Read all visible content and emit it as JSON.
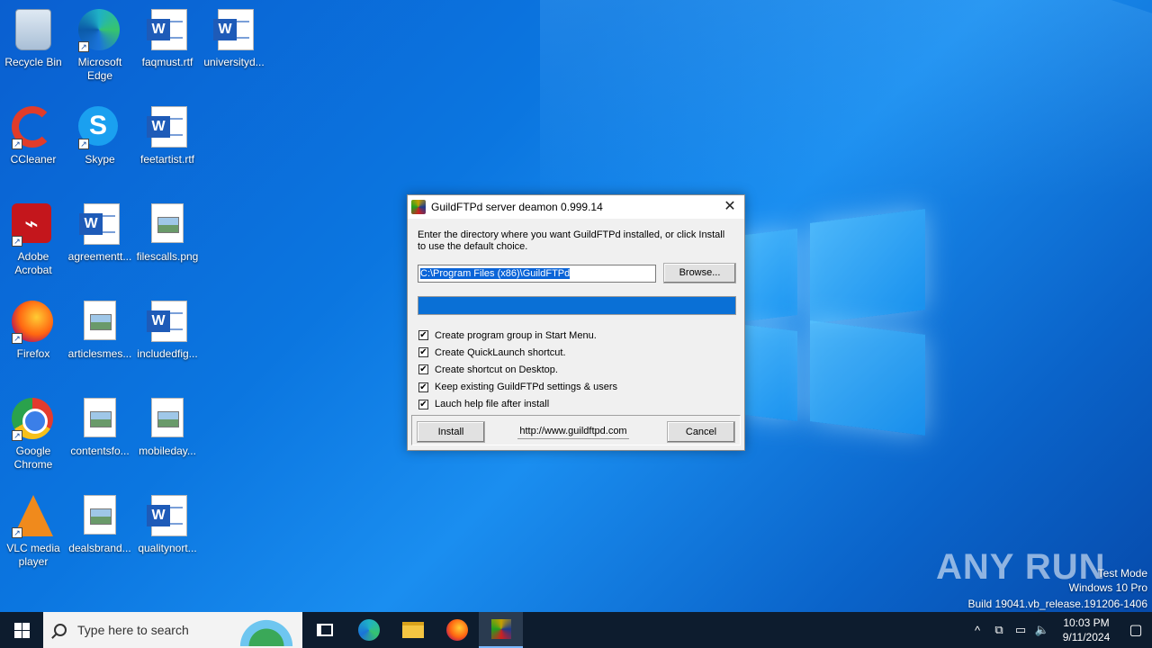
{
  "desktop": {
    "icons": [
      {
        "label": "Recycle Bin"
      },
      {
        "label": "Microsoft Edge"
      },
      {
        "label": "faqmust.rtf"
      },
      {
        "label": "universityd..."
      },
      {
        "label": "CCleaner"
      },
      {
        "label": "Skype"
      },
      {
        "label": "feetartist.rtf"
      },
      {
        "label": "Adobe Acrobat"
      },
      {
        "label": "agreementt..."
      },
      {
        "label": "filescalls.png"
      },
      {
        "label": "Firefox"
      },
      {
        "label": "articlesmes..."
      },
      {
        "label": "includedfig..."
      },
      {
        "label": "Google Chrome"
      },
      {
        "label": "contentsfo..."
      },
      {
        "label": "mobileday..."
      },
      {
        "label": "VLC media player"
      },
      {
        "label": "dealsbrand..."
      },
      {
        "label": "qualitynort..."
      }
    ]
  },
  "dialog": {
    "title": "GuildFTPd server deamon 0.999.14",
    "close_glyph": "✕",
    "description": "Enter the directory where you want GuildFTPd installed, or click Install to use the default choice.",
    "path_value": "C:\\Program Files (x86)\\GuildFTPd",
    "browse_label": "Browse...",
    "progress_percent": 100,
    "checkboxes": [
      {
        "label": "Create program group in Start Menu.",
        "checked": true
      },
      {
        "label": "Create QuickLaunch shortcut.",
        "checked": true
      },
      {
        "label": "Create shortcut on Desktop.",
        "checked": true
      },
      {
        "label": "Keep existing GuildFTPd settings & users",
        "checked": true
      },
      {
        "label": "Lauch help file after install",
        "checked": true
      }
    ],
    "check_glyph": "✔",
    "install_label": "Install",
    "url_text": "http://www.guildftpd.com",
    "cancel_label": "Cancel"
  },
  "watermark": {
    "logo": "ANY RUN",
    "mode": "Test Mode",
    "edition": "Windows 10 Pro",
    "build": "Build 19041.vb_release.191206-1406"
  },
  "taskbar": {
    "search_placeholder": "Type here to search",
    "time": "10:03 PM",
    "date": "9/11/2024",
    "tray_chevron": "^",
    "notification_glyph": "▢"
  },
  "colors": {
    "accent": "#0a70d6",
    "taskbar": "#0d1c2e"
  }
}
